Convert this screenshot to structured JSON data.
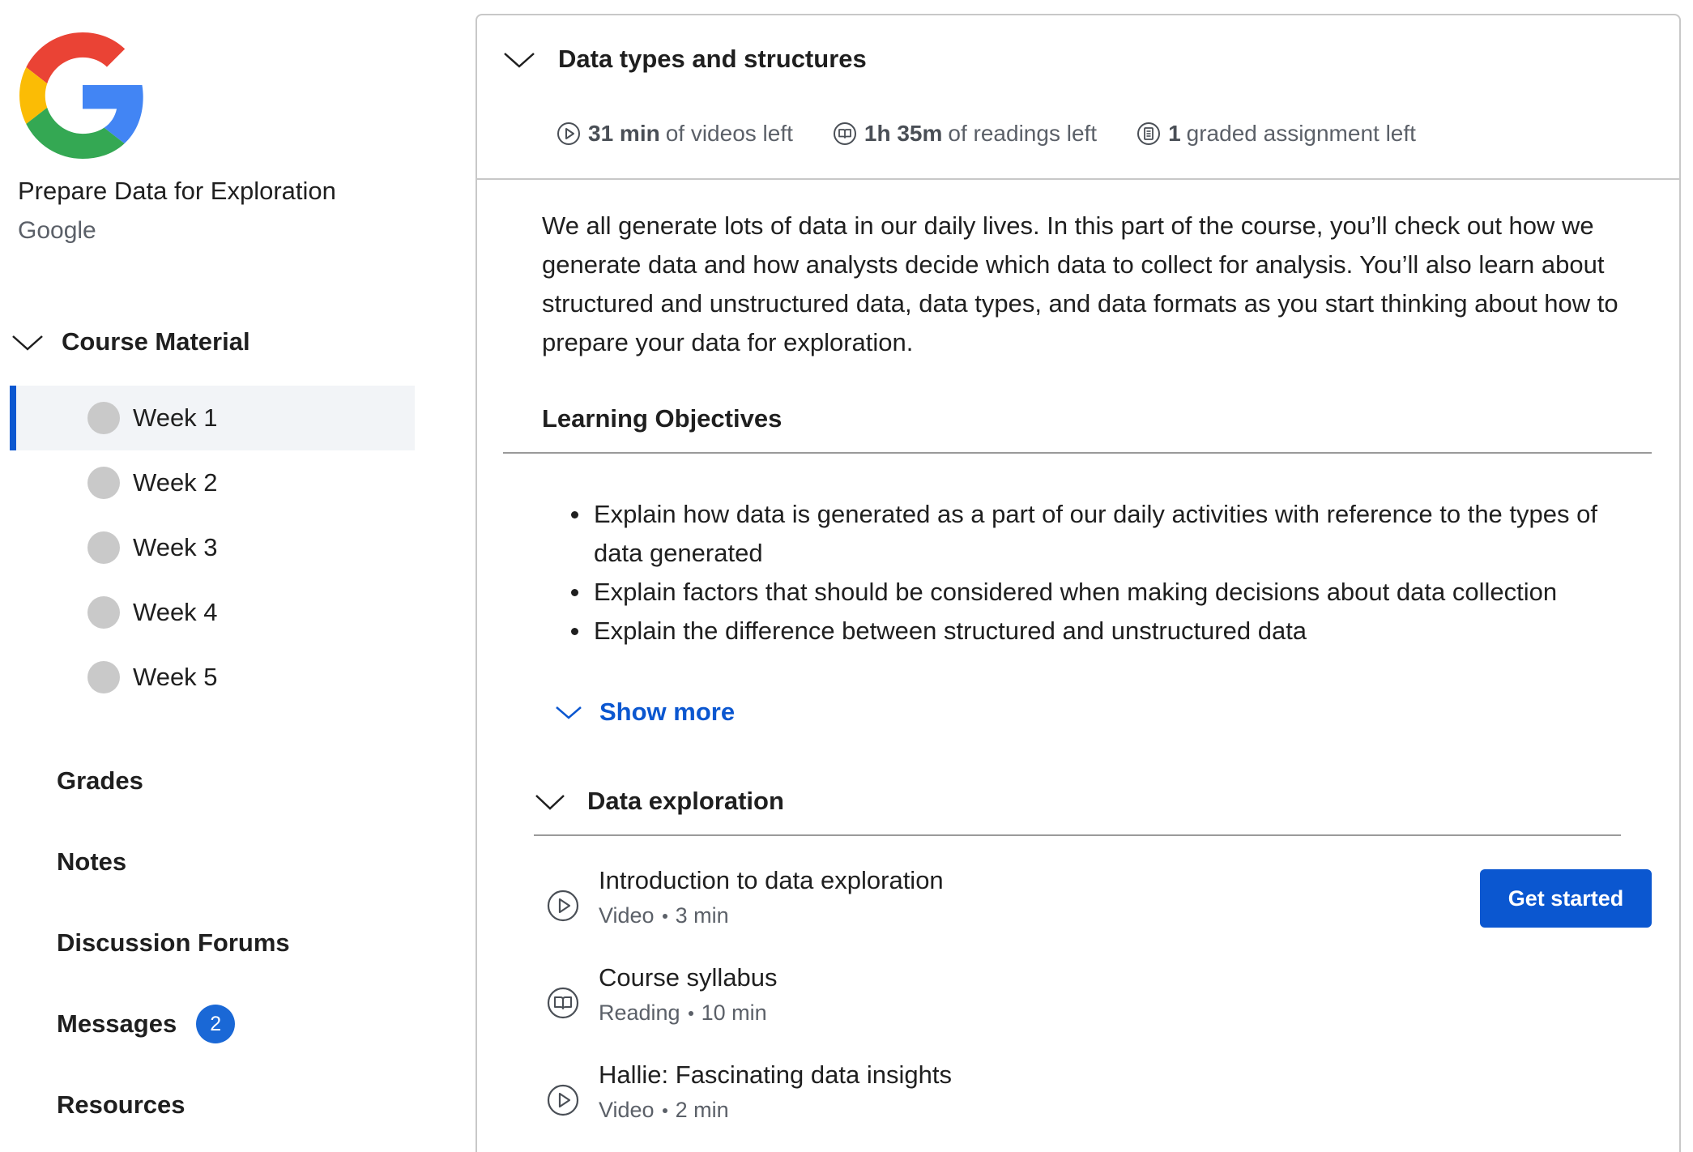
{
  "sidebar": {
    "course_title": "Prepare Data for Exploration",
    "course_org": "Google",
    "section_label": "Course Material",
    "weeks": [
      {
        "label": "Week 1",
        "active": true
      },
      {
        "label": "Week 2",
        "active": false
      },
      {
        "label": "Week 3",
        "active": false
      },
      {
        "label": "Week 4",
        "active": false
      },
      {
        "label": "Week 5",
        "active": false
      }
    ],
    "nav": {
      "grades": "Grades",
      "notes": "Notes",
      "forums": "Discussion Forums",
      "messages": "Messages",
      "messages_count": "2",
      "resources": "Resources"
    }
  },
  "main": {
    "module_title": "Data types and structures",
    "stats": {
      "videos_value": "31 min",
      "videos_suffix": "of videos left",
      "readings_value": "1h 35m",
      "readings_suffix": "of readings left",
      "assign_value": "1",
      "assign_suffix": "graded assignment left"
    },
    "description": "We all generate lots of data in our daily lives. In this part of the course, you’ll check out how we generate data and how analysts decide which data to collect for analysis. You’ll also learn about structured and unstructured data, data types, and data formats as you start thinking about how to prepare your data for exploration.",
    "objectives_title": "Learning Objectives",
    "objectives": [
      "Explain how data is generated as a part of our daily activities with reference to the types of data generated",
      "Explain factors that should be considered when making decisions about data collection",
      "Explain the difference between structured and unstructured data"
    ],
    "show_more": "Show more",
    "lesson_title": "Data exploration",
    "items": [
      {
        "title": "Introduction to data exploration",
        "type": "Video",
        "duration": "3 min",
        "icon": "play-circle-icon"
      },
      {
        "title": "Course syllabus",
        "type": "Reading",
        "duration": "10 min",
        "icon": "book-icon"
      },
      {
        "title": "Hallie: Fascinating data insights",
        "type": "Video",
        "duration": "2 min",
        "icon": "play-circle-icon"
      }
    ],
    "cta_label": "Get started"
  },
  "colors": {
    "accent": "#0b57d0",
    "badge": "#1a68d6",
    "active_row": "#f2f4f7",
    "muted_text": "#5b6068"
  }
}
